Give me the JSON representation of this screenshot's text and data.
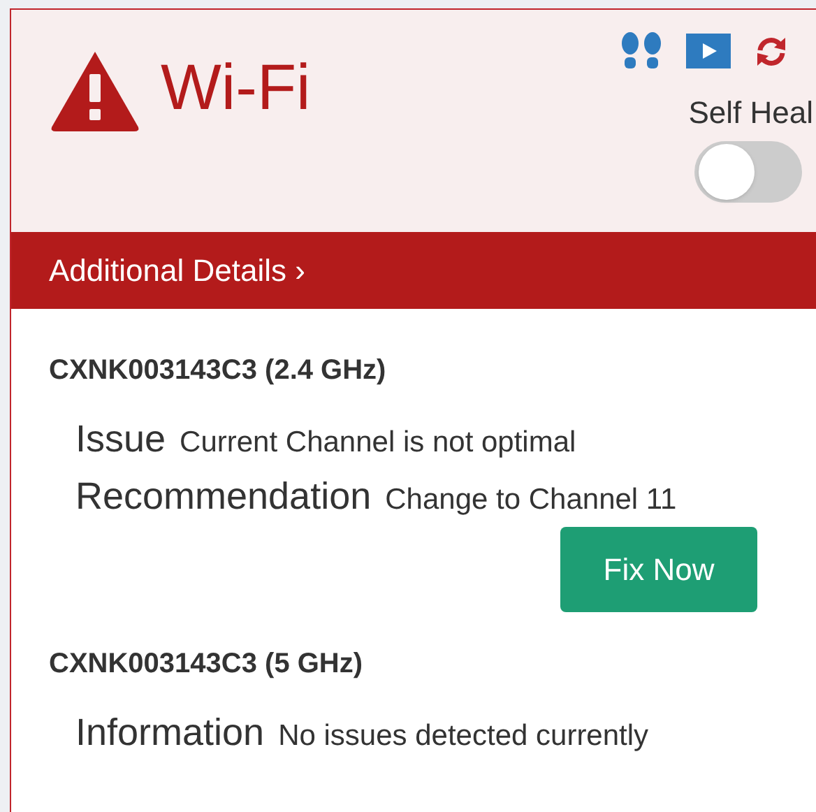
{
  "header": {
    "title": "Wi-Fi"
  },
  "self_heal": {
    "label": "Self Heal",
    "on": false
  },
  "details_bar": {
    "label": "Additional Details ›"
  },
  "sections": [
    {
      "heading": "CXNK003143C3 (2.4 GHz)",
      "rows": [
        {
          "label": "Issue",
          "value": "Current Channel is not optimal"
        },
        {
          "label": "Recommendation",
          "value": "Change to Channel 11"
        }
      ],
      "button": "Fix Now"
    },
    {
      "heading": "CXNK003143C3 (5 GHz)",
      "rows": [
        {
          "label": "Information",
          "value": "No issues detected currently"
        }
      ]
    }
  ]
}
